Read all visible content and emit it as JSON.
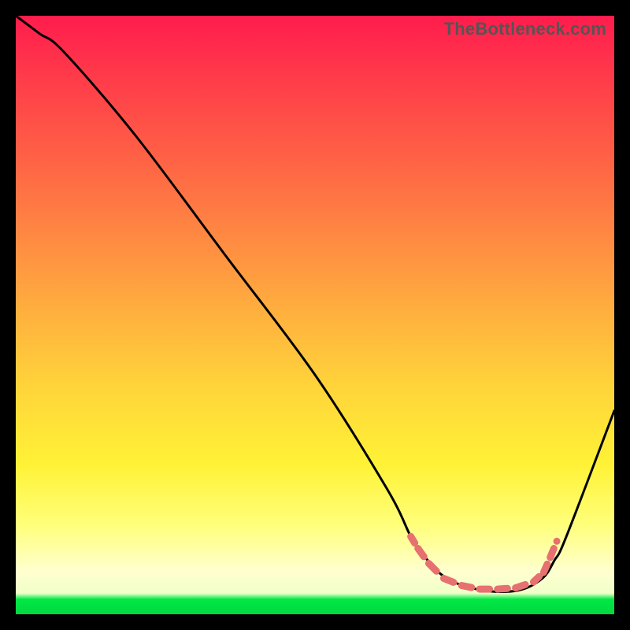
{
  "watermark": "TheBottleneck.com",
  "chart_data": {
    "type": "line",
    "title": "",
    "xlabel": "",
    "ylabel": "",
    "xlim": [
      0,
      100
    ],
    "ylim": [
      0,
      100
    ],
    "series": [
      {
        "name": "curve",
        "x": [
          0,
          4,
          8,
          20,
          35,
          50,
          62,
          66,
          68,
          72,
          78,
          84,
          88,
          90,
          92,
          100
        ],
        "y": [
          100,
          97,
          94,
          80,
          60,
          40,
          21,
          13,
          10,
          6,
          4,
          4,
          6,
          9,
          13,
          34
        ],
        "stroke": "#000000",
        "stroke_width": 3
      }
    ],
    "markers": {
      "name": "dotted-segment",
      "shape": "rounded-dash",
      "stroke": "#e77070",
      "stroke_width": 9,
      "x": [
        66.0,
        67.2,
        69.0,
        71.5,
        74.5,
        77.5,
        80.5,
        83.5,
        86.5,
        88.2,
        89.3,
        90.4
      ],
      "y": [
        13.0,
        11.0,
        8.5,
        6.0,
        4.8,
        4.2,
        4.2,
        4.4,
        5.4,
        7.0,
        9.5,
        12.2
      ]
    }
  }
}
